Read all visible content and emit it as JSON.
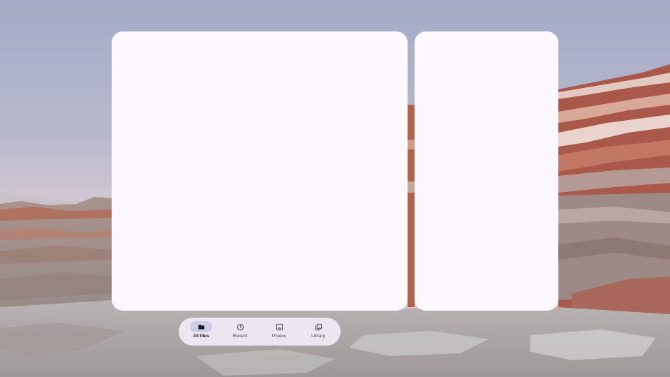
{
  "nav": {
    "items": [
      {
        "label": "All files",
        "icon": "folder-icon",
        "active": true
      },
      {
        "label": "Recent",
        "icon": "clock-icon",
        "active": false
      },
      {
        "label": "Photos",
        "icon": "image-icon",
        "active": false
      },
      {
        "label": "Library",
        "icon": "library-icon",
        "active": false
      }
    ]
  },
  "colors": {
    "panel": "#fdf7ff",
    "nav_bar": "#ece6f0",
    "active_indicator": "#cfcde6",
    "label_active": "#1d1b20",
    "label_inactive": "#49454f"
  }
}
